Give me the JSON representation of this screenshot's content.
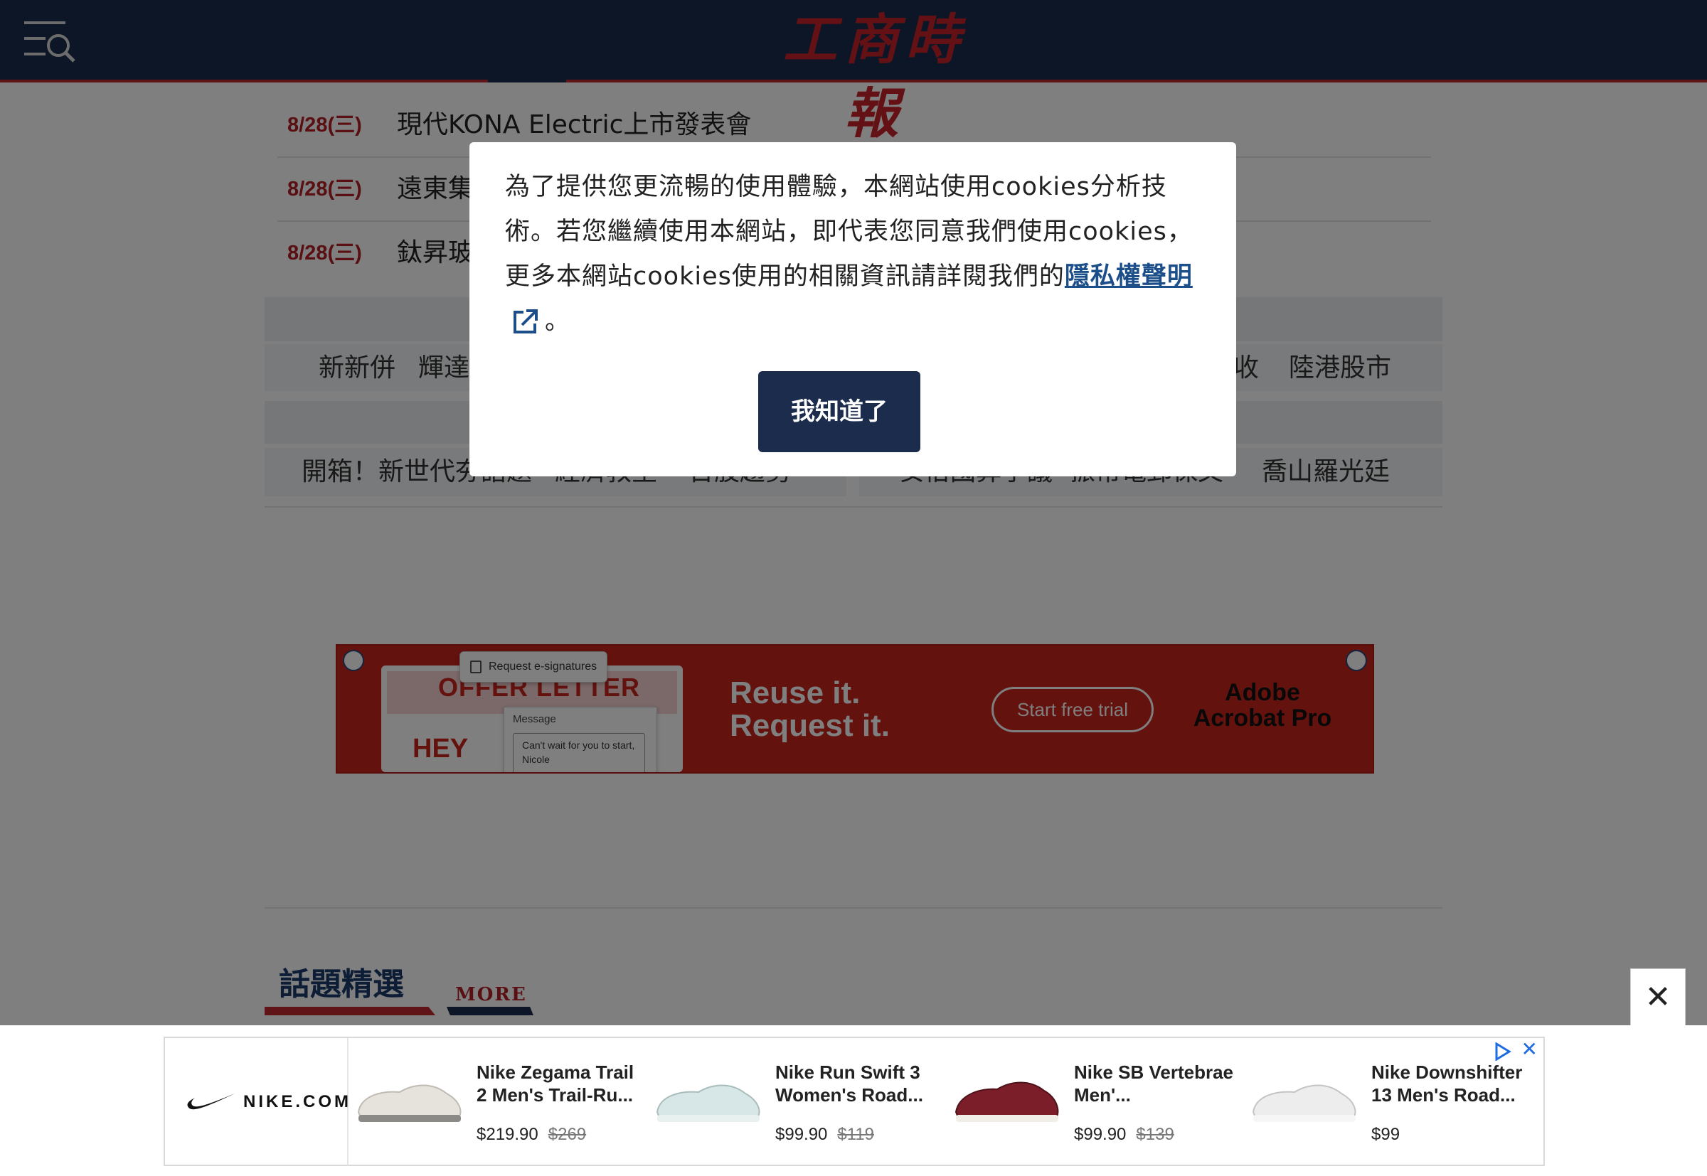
{
  "header": {
    "logo_text": "工商時報",
    "menu_icon": "menu-search-icon"
  },
  "events": [
    {
      "date": "8/28(三)",
      "title": "現代KONA Electric上市發表會"
    },
    {
      "date": "8/28(三)",
      "title": "遠東集"
    },
    {
      "date": "8/28(三)",
      "title": "鈦昇玻"
    }
  ],
  "tags_row1": [
    "新新併",
    "輝達",
    "收",
    "陸港股市"
  ],
  "tags_row2_left": [
    "開箱！新世代夯話題",
    "經濟教室",
    "台股趨勢"
  ],
  "tags_row2_right": [
    "安倍國葬爭議",
    "振幣電郵保文",
    "喬山羅光廷"
  ],
  "adobe_ad": {
    "card_title": "OFFER LETTER",
    "card_greeting": "HEY",
    "request_label": "Request e-signatures",
    "message_label": "Message",
    "message_text": "Can't wait for you to start, Nicole",
    "headline_1": "Reuse it.",
    "headline_2": "Request it.",
    "cta": "Start free trial",
    "brand_1": "Adobe",
    "brand_2": "Acrobat Pro"
  },
  "section": {
    "title": "話題精選",
    "more": "MORE"
  },
  "cookie_modal": {
    "text": "為了提供您更流暢的使用體驗，本網站使用cookies分析技術。若您繼續使用本網站，即代表您同意我們使用cookies，更多本網站cookies使用的相關資訊請詳閱我們的",
    "link": "隱私權聲明",
    "tail": "。",
    "button": "我知道了"
  },
  "bottom_ad": {
    "close_symbol": "✕",
    "brand": "NIKE.COM",
    "ad_close": "✕",
    "products": [
      {
        "name": "Nike Zegama Trail 2 Men's Trail-Ru...",
        "price": "$219.90",
        "old_price": "$269",
        "color": "#e6e3dd"
      },
      {
        "name": "Nike Run Swift 3 Women's Road...",
        "price": "$99.90",
        "old_price": "$119",
        "color": "#d7e6e6"
      },
      {
        "name": "Nike SB Vertebrae Men'...",
        "price": "$99.90",
        "old_price": "$139",
        "color": "#7b1e2a"
      },
      {
        "name": "Nike Downshifter 13 Men's Road...",
        "price": "$99",
        "old_price": "",
        "color": "#ededed"
      }
    ]
  },
  "colors": {
    "navy": "#1b2c4d",
    "red": "#c0282f",
    "link": "#1c4f8a",
    "ad_red": "#c7241d"
  }
}
